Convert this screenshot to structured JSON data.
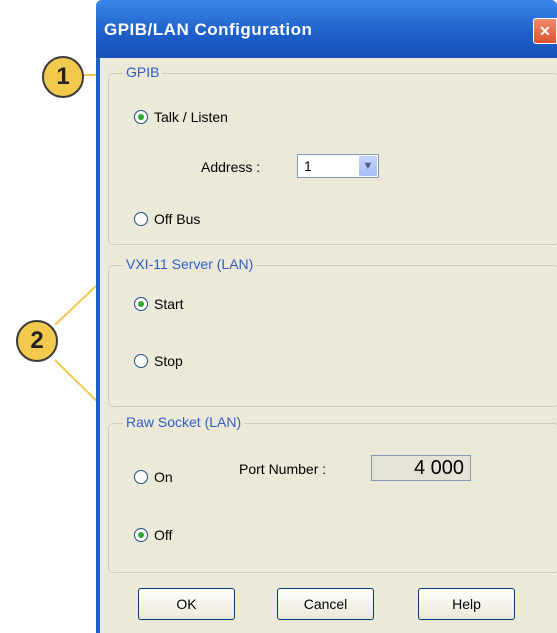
{
  "window": {
    "title": "GPIB/LAN Configuration",
    "close_label": "✕"
  },
  "gpib": {
    "label": "GPIB",
    "talk_listen": "Talk / Listen",
    "address_label": "Address :",
    "address_value": "1",
    "off_bus": "Off Bus"
  },
  "vxi": {
    "label": "VXI-11 Server (LAN)",
    "start": "Start",
    "stop": "Stop"
  },
  "raw": {
    "label": "Raw Socket (LAN)",
    "on": "On",
    "off": "Off",
    "port_label": "Port Number :",
    "port_value": "4 000"
  },
  "buttons": {
    "ok": "OK",
    "cancel": "Cancel",
    "help": "Help"
  },
  "callouts": {
    "one": "1",
    "two": "2"
  },
  "colors": {
    "callout": "#f2c94c",
    "group_label": "#2f5ec7",
    "title_bar": "#1d5ec9"
  }
}
